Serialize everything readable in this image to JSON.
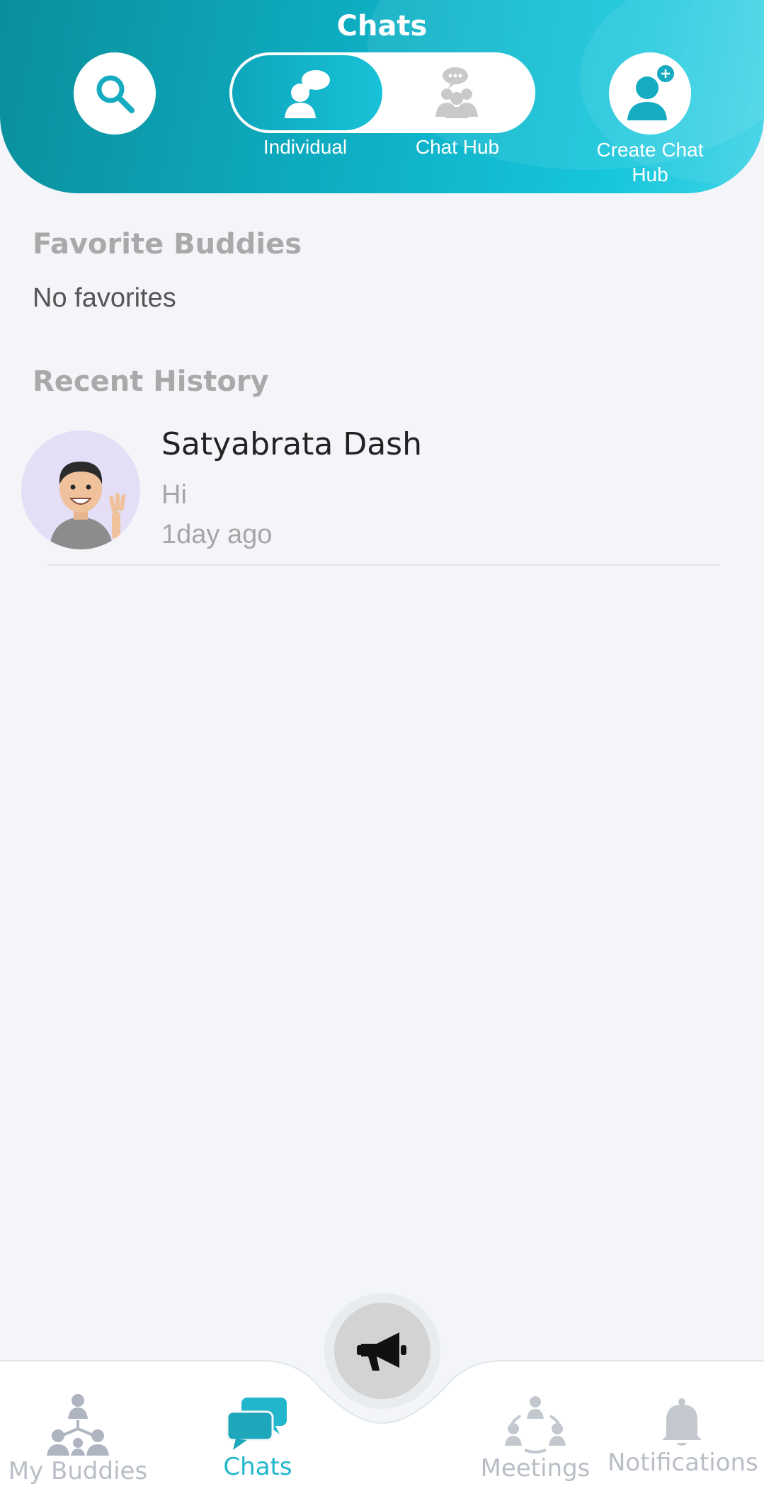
{
  "header": {
    "title": "Chats",
    "search_icon": "search-icon",
    "toggle": {
      "individual_label": "Individual",
      "chathub_label": "Chat Hub",
      "active": "Individual"
    },
    "create_chat_hub_label": "Create Chat Hub"
  },
  "favorites": {
    "title": "Favorite Buddies",
    "empty_text": "No favorites"
  },
  "recent": {
    "title": "Recent History",
    "items": [
      {
        "name": "Satyabrata Dash",
        "message": "Hi",
        "time": "1day ago",
        "avatar": "avatar-waving-man"
      }
    ]
  },
  "bottom_nav": {
    "items": [
      {
        "label": "My Buddies",
        "icon": "buddies-network-icon",
        "active": false
      },
      {
        "label": "Chats",
        "icon": "chat-bubbles-icon",
        "active": true
      },
      {
        "label": "Meetings",
        "icon": "meetings-icon",
        "active": false
      },
      {
        "label": "Notifications",
        "icon": "bell-icon",
        "active": false
      }
    ],
    "center_button_icon": "megaphone-icon"
  },
  "colors": {
    "accent": "#21b6cb",
    "header_start": "#0a8f9c",
    "header_end": "#3fd3e6",
    "background": "#f3f5f9"
  }
}
